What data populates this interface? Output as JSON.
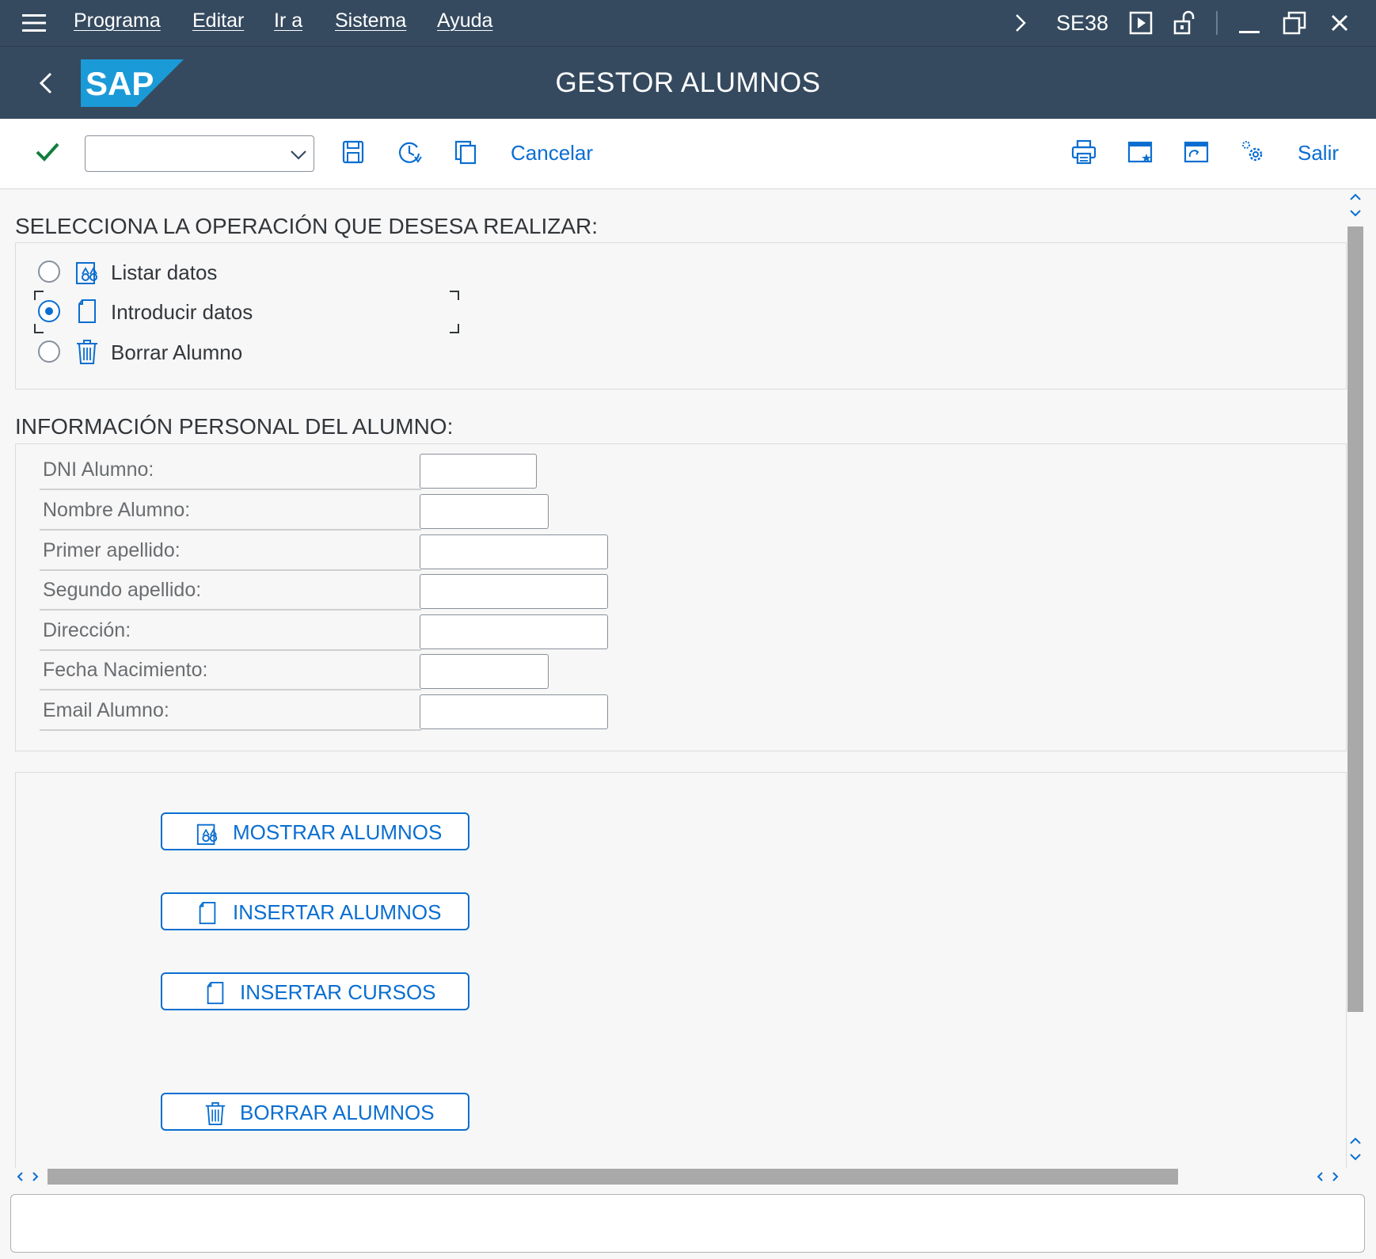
{
  "menu": {
    "items": [
      "Programa",
      "Editar",
      "Ir a",
      "Sistema",
      "Ayuda"
    ],
    "command": "SE38"
  },
  "header": {
    "title": "GESTOR ALUMNOS",
    "logo": "SAP"
  },
  "toolbar": {
    "command_value": "",
    "cancel_label": "Cancelar",
    "exit_label": "Salir"
  },
  "operation": {
    "title": "SELECCIONA LA OPERACIÓN QUE DESESA REALIZAR:",
    "options": [
      {
        "label": "Listar datos",
        "icon": "display-icon",
        "selected": false
      },
      {
        "label": "Introducir datos",
        "icon": "document-icon",
        "selected": true
      },
      {
        "label": "Borrar Alumno",
        "icon": "trash-icon",
        "selected": false
      }
    ]
  },
  "personal": {
    "title": "INFORMACIÓN PERSONAL DEL ALUMNO:",
    "fields": [
      {
        "label": "DNI Alumno:",
        "value": ""
      },
      {
        "label": "Nombre Alumno:",
        "value": ""
      },
      {
        "label": "Primer apellido:",
        "value": ""
      },
      {
        "label": "Segundo apellido:",
        "value": ""
      },
      {
        "label": "Dirección:",
        "value": ""
      },
      {
        "label": "Fecha Nacimiento:",
        "value": ""
      },
      {
        "label": "Email Alumno:",
        "value": ""
      }
    ]
  },
  "actions": {
    "buttons": [
      {
        "label": "MOSTRAR ALUMNOS",
        "icon": "display-icon"
      },
      {
        "label": "INSERTAR ALUMNOS",
        "icon": "document-icon"
      },
      {
        "label": "INSERTAR CURSOS",
        "icon": "document-icon"
      },
      {
        "label": "BORRAR ALUMNOS",
        "icon": "trash-icon"
      }
    ]
  },
  "colors": {
    "shell": "#354a5f",
    "accent": "#0a6ed1",
    "check": "#107e3e",
    "background": "#f7f7f7"
  }
}
